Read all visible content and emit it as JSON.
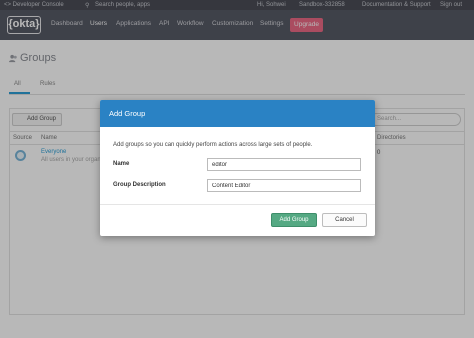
{
  "topbar": {
    "console": "<> Developer Console",
    "search_placeholder": "Search people, apps",
    "user": "Hi, Sohwei",
    "org": "Sandbox-332858",
    "docs": "Documentation & Support",
    "sign_out": "Sign out"
  },
  "navbar": {
    "logo": "{okta}",
    "items": [
      "Dashboard",
      "Users",
      "Applications",
      "API",
      "Workflow",
      "Customization",
      "Settings"
    ],
    "active_item": "Users",
    "upgrade": "Upgrade"
  },
  "page": {
    "title": "Groups",
    "tabs": [
      "All",
      "Rules"
    ],
    "add_group_button": "Add Group",
    "search_placeholder": "Search...",
    "columns": [
      "Source",
      "Name",
      "Directories"
    ],
    "rows": [
      {
        "name": "Everyone",
        "description": "All users in your organization",
        "directories": "0"
      }
    ]
  },
  "modal": {
    "title": "Add Group",
    "description": "Add groups so you can quickly perform actions across large sets of people.",
    "fields": [
      {
        "label": "Name",
        "value": "editor"
      },
      {
        "label": "Group Description",
        "value": "Content Editor"
      }
    ],
    "primary_button": "Add Group",
    "cancel_button": "Cancel"
  },
  "colors": {
    "nav_bg": "#575a66",
    "topbar_bg": "#4b4d57",
    "upgrade": "#ec6a86",
    "modal_header": "#2a82c4",
    "primary_button": "#55a983",
    "link": "#2d9fd6"
  }
}
